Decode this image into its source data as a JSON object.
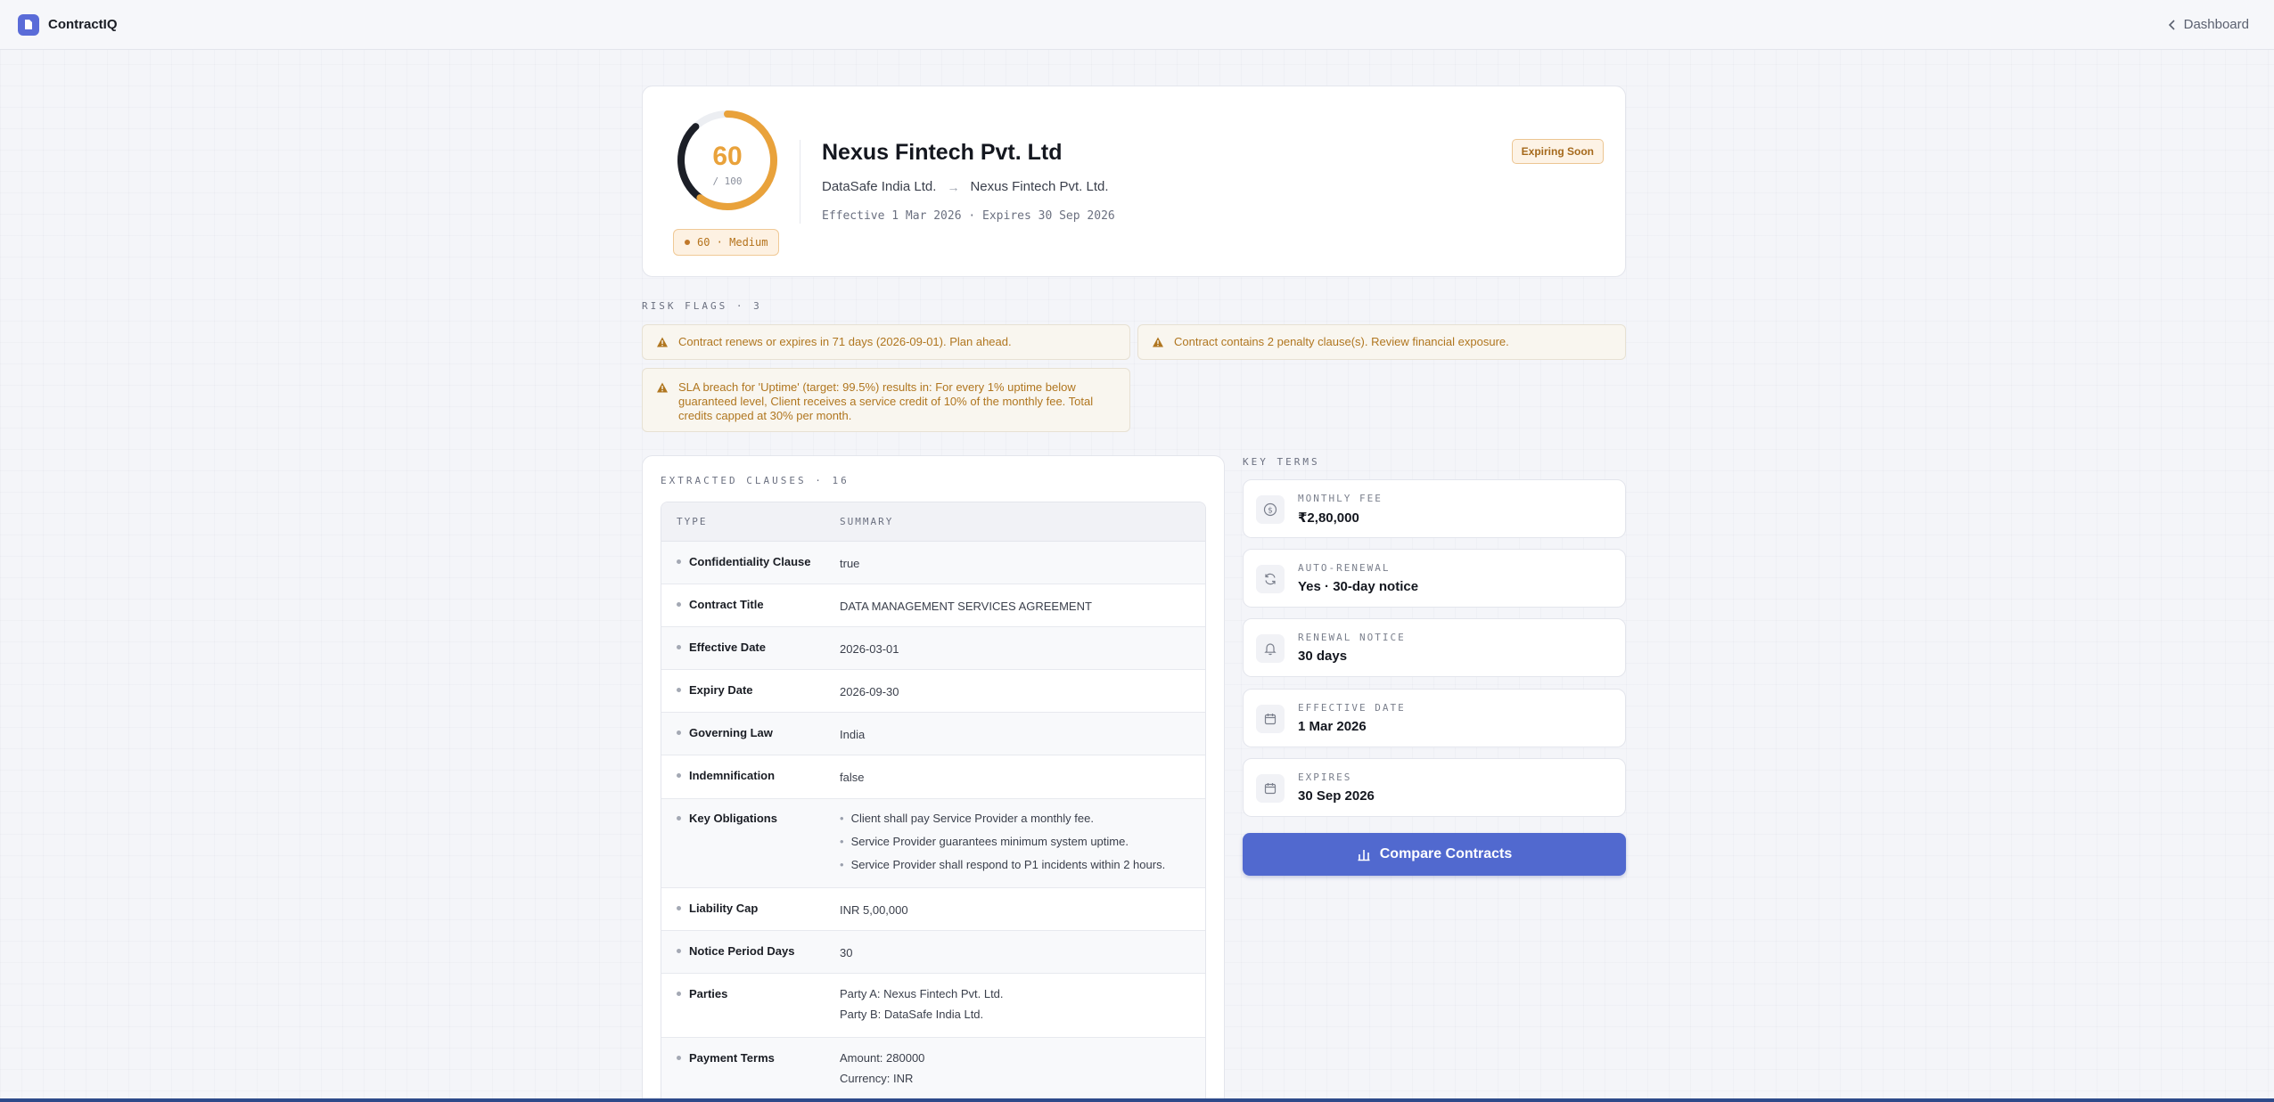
{
  "app": {
    "name": "ContractIQ",
    "back_label": "Dashboard"
  },
  "header": {
    "score": "60",
    "score_max": "/ 100",
    "score_fraction": 0.6,
    "risk_level_label": "60 · Medium",
    "title": "Nexus Fintech Pvt. Ltd",
    "party_from": "DataSafe India Ltd.",
    "party_to": "Nexus Fintech Pvt. Ltd.",
    "dates": "Effective 1 Mar 2026 · Expires 30 Sep 2026",
    "status": "Expiring Soon"
  },
  "risk_flags": {
    "label": "RISK FLAGS · 3",
    "items": [
      "Contract renews or expires in 71 days (2026-09-01). Plan ahead.",
      "Contract contains 2 penalty clause(s). Review financial exposure.",
      "SLA breach for 'Uptime' (target: 99.5%) results in: For every 1% uptime below guaranteed level, Client receives a service credit of 10% of the monthly fee. Total credits capped at 30% per month."
    ]
  },
  "clauses": {
    "label": "EXTRACTED CLAUSES · 16",
    "col_type": "TYPE",
    "col_summary": "SUMMARY",
    "rows": [
      {
        "type": "Confidentiality Clause",
        "summary": "true"
      },
      {
        "type": "Contract Title",
        "summary": "DATA MANAGEMENT SERVICES AGREEMENT"
      },
      {
        "type": "Effective Date",
        "summary": "2026-03-01"
      },
      {
        "type": "Expiry Date",
        "summary": "2026-09-30"
      },
      {
        "type": "Governing Law",
        "summary": "India"
      },
      {
        "type": "Indemnification",
        "summary": "false"
      },
      {
        "type": "Key Obligations",
        "bullets": [
          "Client shall pay Service Provider a monthly fee.",
          "Service Provider guarantees minimum system uptime.",
          "Service Provider shall respond to P1 incidents within 2 hours."
        ]
      },
      {
        "type": "Liability Cap",
        "summary": "INR 5,00,000"
      },
      {
        "type": "Notice Period Days",
        "summary": "30"
      },
      {
        "type": "Parties",
        "lines": [
          "Party A: Nexus Fintech Pvt. Ltd.",
          "Party B: DataSafe India Ltd."
        ]
      },
      {
        "type": "Payment Terms",
        "lines": [
          "Amount: 280000",
          "Currency: INR"
        ]
      }
    ]
  },
  "key_terms": {
    "label": "KEY TERMS",
    "items": [
      {
        "label": "MONTHLY FEE",
        "value": "₹2,80,000",
        "icon": "dollar-icon"
      },
      {
        "label": "AUTO-RENEWAL",
        "value": "Yes · 30-day notice",
        "icon": "refresh-icon"
      },
      {
        "label": "RENEWAL NOTICE",
        "value": "30 days",
        "icon": "bell-icon"
      },
      {
        "label": "EFFECTIVE DATE",
        "value": "1 Mar 2026",
        "icon": "calendar-icon"
      },
      {
        "label": "EXPIRES",
        "value": "30 Sep 2026",
        "icon": "calendar-icon"
      }
    ],
    "compare_label": "Compare Contracts"
  },
  "colors": {
    "accent": "#5169cf",
    "warning": "#e9a23b",
    "flag_text": "#b0761f"
  }
}
